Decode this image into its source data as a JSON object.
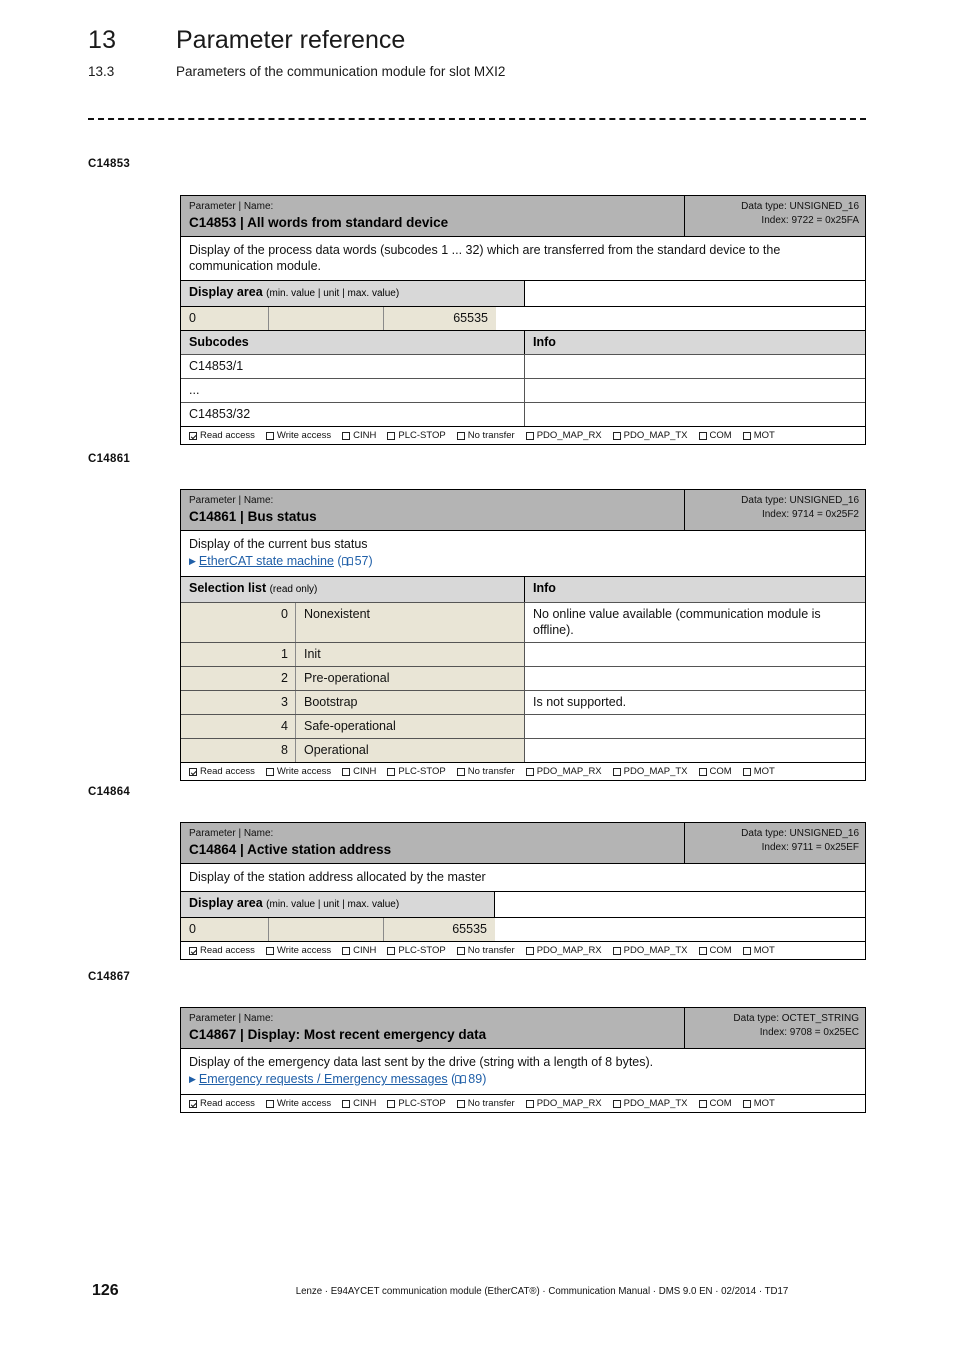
{
  "header": {
    "chapter_number": "13",
    "chapter_title": "Parameter reference",
    "section_number": "13.3",
    "section_title": "Parameters of the communication module for slot MXI2"
  },
  "access_labels": {
    "read": "Read access",
    "write": "Write access",
    "cinh": "CINH",
    "plc_stop": "PLC-STOP",
    "no_transfer": "No transfer",
    "pdo_map_rx": "PDO_MAP_RX",
    "pdo_map_tx": "PDO_MAP_TX",
    "com": "COM",
    "mot": "MOT"
  },
  "labels": {
    "parameter_name": "Parameter | Name:",
    "display_area": "Display area",
    "display_area_sub": "(min. value | unit | max. value)",
    "subcodes": "Subcodes",
    "info": "Info",
    "selection_list": "Selection list",
    "selection_list_sub": "(read only)"
  },
  "colors": {
    "title_band": "#b4b4b4",
    "section_head": "#d8d8d8",
    "value_cell": "#e9e5d6",
    "link": "#1f5fa8"
  },
  "params": [
    {
      "margin": "C14853",
      "title_small": "Parameter | Name:",
      "title_big": "C14853 | All words from standard device",
      "data_type": "Data type: UNSIGNED_16",
      "index": "Index: 9722 = 0x25FA",
      "description": "Display of the process data words (subcodes 1 ... 32) which are transferred from the standard device to the communication module.",
      "display_area": {
        "min": "0",
        "unit": "",
        "max": "65535"
      },
      "subcodes": [
        {
          "code": "C14853/1",
          "info": ""
        },
        {
          "code": "...",
          "info": ""
        },
        {
          "code": "C14853/32",
          "info": ""
        }
      ]
    },
    {
      "margin": "C14861",
      "title_small": "Parameter | Name:",
      "title_big": "C14861 | Bus status",
      "data_type": "Data type: UNSIGNED_16",
      "index": "Index: 9714 = 0x25F2",
      "description": "Display of the current bus status",
      "xref": {
        "text": "EtherCAT state machine",
        "page": "57"
      },
      "selection_list": [
        {
          "value": "0",
          "label": "Nonexistent",
          "info": "No online value available (communication module is offline)."
        },
        {
          "value": "1",
          "label": "Init",
          "info": ""
        },
        {
          "value": "2",
          "label": "Pre-operational",
          "info": ""
        },
        {
          "value": "3",
          "label": "Bootstrap",
          "info": "Is not supported."
        },
        {
          "value": "4",
          "label": "Safe-operational",
          "info": ""
        },
        {
          "value": "8",
          "label": "Operational",
          "info": ""
        }
      ]
    },
    {
      "margin": "C14864",
      "title_small": "Parameter | Name:",
      "title_big": "C14864 | Active station address",
      "data_type": "Data type: UNSIGNED_16",
      "index": "Index: 9711 = 0x25EF",
      "description": "Display of the station address allocated by the master",
      "display_area": {
        "min": "0",
        "unit": "",
        "max": "65535"
      }
    },
    {
      "margin": "C14867",
      "title_small": "Parameter | Name:",
      "title_big": "C14867 | Display: Most recent emergency data",
      "data_type": "Data type: OCTET_STRING",
      "index": "Index: 9708 = 0x25EC",
      "description": "Display of the emergency data last sent by the drive (string with a length of 8 bytes).",
      "xref": {
        "text": "Emergency requests / Emergency messages",
        "page": "89"
      }
    }
  ],
  "footer": {
    "page_number": "126",
    "text": "Lenze · E94AYCET communication module (EtherCAT®) · Communication Manual · DMS 9.0 EN · 02/2014 · TD17"
  }
}
